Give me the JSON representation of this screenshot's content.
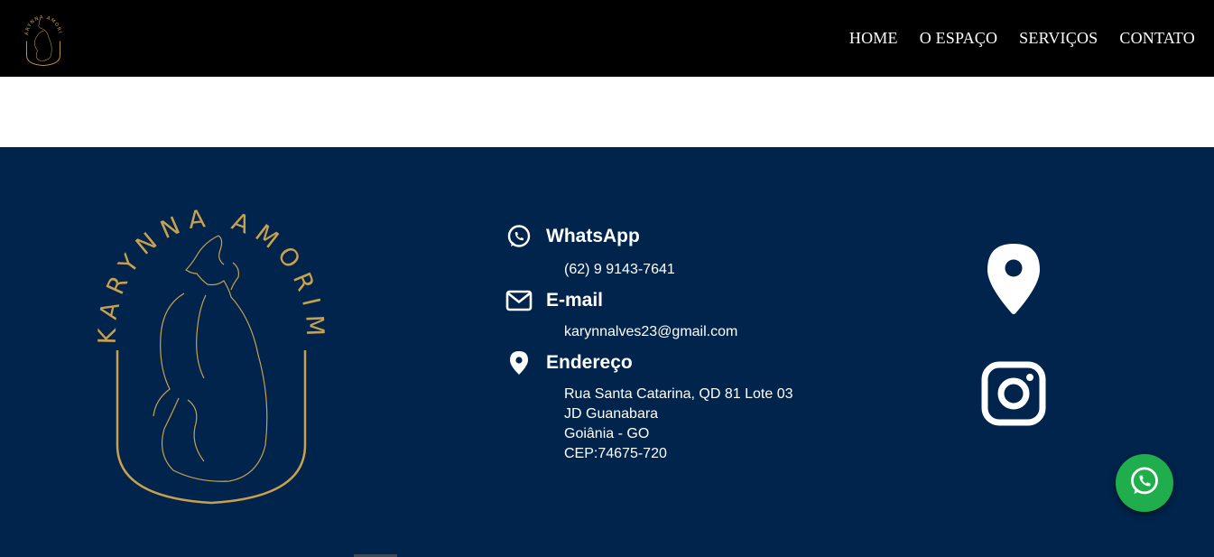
{
  "brand": {
    "name": "KARYNNA AMORIM",
    "gold": "#c9a14e",
    "logo_icon": "woman-silhouette-logo"
  },
  "nav": {
    "items": [
      {
        "label": "HOME"
      },
      {
        "label": "O ESPAÇO"
      },
      {
        "label": "SERVIÇOS"
      },
      {
        "label": "CONTATO"
      }
    ]
  },
  "colors": {
    "header_bg": "#000000",
    "footer_bg": "#00244c",
    "whatsapp_green": "#1fae4b",
    "text": "#ffffff"
  },
  "contact": {
    "whatsapp": {
      "icon": "whatsapp-icon",
      "title": "WhatsApp",
      "value": "(62) 9 9143-7641"
    },
    "email": {
      "icon": "envelope-icon",
      "title": "E-mail",
      "value": "karynnalves23@gmail.com"
    },
    "address": {
      "icon": "location-pin-icon",
      "title": "Endereço",
      "lines": [
        "Rua Santa Catarina, QD 81 Lote 03",
        "JD Guanabara",
        "Goiânia - GO",
        "CEP:74675-720"
      ]
    }
  },
  "social": {
    "map_icon": "location-pin-icon",
    "instagram_icon": "instagram-icon",
    "floating_whatsapp_icon": "whatsapp-icon"
  }
}
